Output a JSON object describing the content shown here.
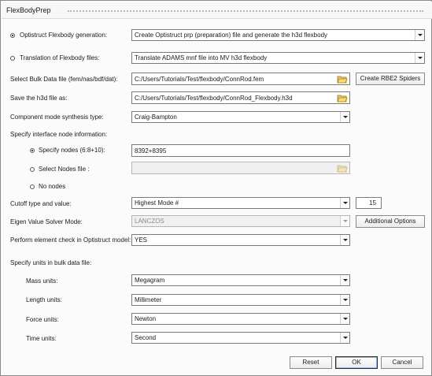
{
  "window": {
    "title": "FlexBodyPrep"
  },
  "mode": {
    "optistruct_label": "Optistruct Flexbody generation:",
    "optistruct_value": "Create Optistruct prp (preparation) file and generate the h3d flexbody",
    "translation_label": "Translation of Flexbody files:",
    "translation_value": "Translate ADAMS mnf file into MV h3d flexbody"
  },
  "bulk_file": {
    "label": "Select Bulk Data file (fem/nas/bdf/dat):",
    "value": "C:/Users/Tutorials/Test/flexbody/ConnRod.fem",
    "rbe2_button": "Create RBE2 Spiders"
  },
  "h3d_file": {
    "label": "Save the h3d file as:",
    "value": "C:/Users/Tutorials/Test/flexbody/ConnRod_Flexbody.h3d"
  },
  "synthesis": {
    "label": "Component mode synthesis type:",
    "value": "Craig-Bampton"
  },
  "interface": {
    "label": "Specify interface node information:",
    "specify_label": "Specify nodes (6:8+10):",
    "specify_value": "8392+8395",
    "select_label": "Select Nodes file :",
    "select_value": "",
    "none_label": "No nodes"
  },
  "cutoff": {
    "label": "Cutoff type and value:",
    "type_value": "Highest Mode #",
    "number_value": "15"
  },
  "eigen": {
    "label": "Eigen Value Solver Mode:",
    "value": "LANCZOS",
    "options_button": "Additional Options"
  },
  "element_check": {
    "label": "Perform element check in Optistruct model:",
    "value": "YES"
  },
  "units": {
    "heading": "Specify units in bulk data file:",
    "mass_label": "Mass units:",
    "mass_value": "Megagram",
    "length_label": "Length units:",
    "length_value": "Millimeter",
    "force_label": "Force units:",
    "force_value": "Newton",
    "time_label": "Time units:",
    "time_value": "Second"
  },
  "footer": {
    "reset": "Reset",
    "ok": "OK",
    "cancel": "Cancel"
  },
  "icons": {
    "folder": "folder-open-icon",
    "dropdown": "chevron-down-icon",
    "grip": "drag-grip-icon"
  },
  "colors": {
    "folder_fill": "#f2c94c",
    "folder_edge": "#9a7a1e",
    "default_button_ring": "#9fb7d8"
  }
}
